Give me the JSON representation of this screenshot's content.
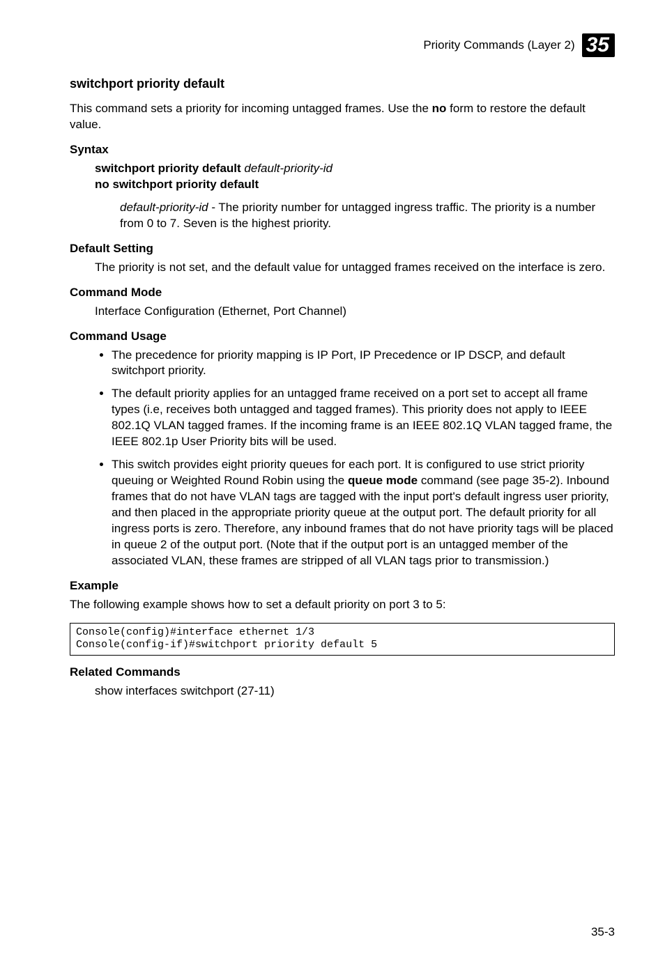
{
  "header": {
    "running_title": "Priority Commands (Layer 2)",
    "chapter_number": "35"
  },
  "section": {
    "title": "switchport priority default",
    "intro_prefix": "This command sets a priority for incoming untagged frames. Use the ",
    "intro_bold": "no",
    "intro_suffix": " form to restore the default value."
  },
  "syntax": {
    "head": "Syntax",
    "line1_cmd": "switchport priority default ",
    "line1_arg": "default-priority-id",
    "line2_cmd": "no switchport priority default",
    "arg_name": "default-priority-id",
    "arg_desc": " - The priority number for untagged ingress traffic. The priority is a number from 0 to 7. Seven is the highest priority."
  },
  "default_setting": {
    "head": "Default Setting",
    "text": "The priority is not set, and the default value for untagged frames received on the interface is zero."
  },
  "command_mode": {
    "head": "Command Mode",
    "text": "Interface Configuration (Ethernet, Port Channel)"
  },
  "command_usage": {
    "head": "Command Usage",
    "bullets": [
      "The precedence for priority mapping is IP Port, IP Precedence or IP DSCP, and default switchport priority.",
      "The default priority applies for an untagged frame received on a port set to accept all frame types (i.e, receives both untagged and tagged frames). This priority does not apply to IEEE 802.1Q VLAN tagged frames. If the incoming frame is an IEEE 802.1Q VLAN tagged frame, the IEEE 802.1p User Priority bits will be used."
    ],
    "bullet3_prefix": "This switch provides eight priority queues for each port. It is configured to use strict priority queuing or Weighted Round Robin using the ",
    "bullet3_bold": "queue mode",
    "bullet3_suffix": " command (see page 35-2). Inbound frames that do not have VLAN tags are tagged with the input port's default ingress user priority, and then placed in the appropriate priority queue at the output port. The default priority for all ingress ports is zero. Therefore, any inbound frames that do not have priority tags will be placed in queue 2 of the output port. (Note that if the output port is an untagged member of the associated VLAN, these frames are stripped of all VLAN tags prior to transmission.)"
  },
  "example": {
    "head": "Example",
    "intro": "The following example shows how to set a default priority on port 3 to 5:",
    "code": "Console(config)#interface ethernet 1/3\nConsole(config-if)#switchport priority default 5"
  },
  "related": {
    "head": "Related Commands",
    "text": "show interfaces switchport (27-11)"
  },
  "footer": {
    "pageno": "35-3"
  }
}
